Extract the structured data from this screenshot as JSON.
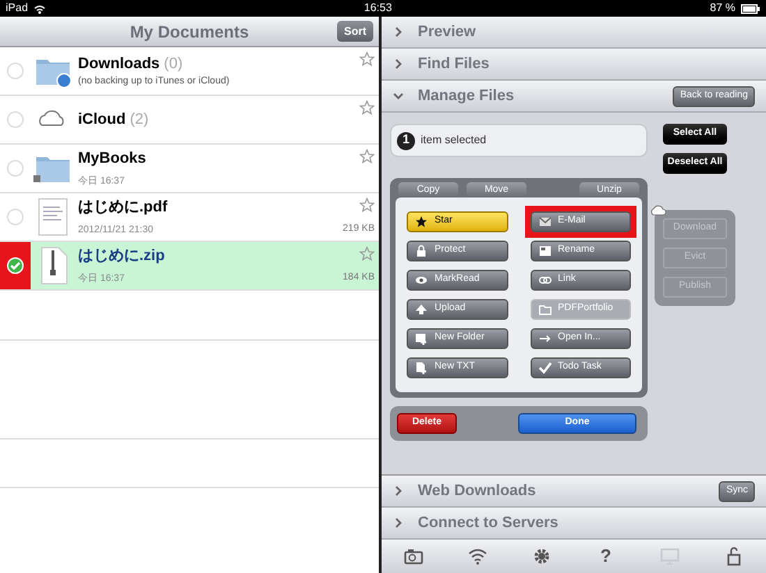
{
  "status_bar": {
    "carrier": "iPad",
    "time": "16:53",
    "battery": "87 %"
  },
  "documents": {
    "title": "My Documents",
    "sort_button": "Sort",
    "items": [
      {
        "kind": "folder-sync",
        "name": "Downloads",
        "count": "(0)",
        "subtitle": "(no backing up to iTunes or iCloud)",
        "selected": false,
        "highlighted": false
      },
      {
        "kind": "cloud",
        "name": "iCloud",
        "count": "(2)",
        "selected": false,
        "highlighted": false
      },
      {
        "kind": "folder-lock",
        "name": "MyBooks",
        "date": "今日 16:37",
        "selected": false,
        "highlighted": false
      },
      {
        "kind": "pdf",
        "name": "はじめに.pdf",
        "date": "2012/11/21 21:30",
        "size": "219 KB",
        "selected": false,
        "highlighted": false
      },
      {
        "kind": "zip",
        "name": "はじめに.zip",
        "date": "今日 16:37",
        "size": "184 KB",
        "selected": true,
        "highlighted": true
      }
    ]
  },
  "sections_top": [
    {
      "label": "Preview",
      "expanded": false
    },
    {
      "label": "Find Files",
      "expanded": false
    },
    {
      "label": "Manage Files",
      "expanded": true,
      "button": "Back to reading"
    }
  ],
  "manage": {
    "count": "1",
    "selection_text": "item selected",
    "select_all": "Select All",
    "deselect_all": "Deselect All",
    "tabs": [
      "Copy",
      "Move",
      "Unzip"
    ],
    "actions": [
      {
        "kind": "star",
        "label": "Star",
        "on": true,
        "disabled": false,
        "highlighted": false
      },
      {
        "kind": "mail",
        "label": "E-Mail",
        "on": false,
        "disabled": false,
        "highlighted": true
      },
      {
        "kind": "lock",
        "label": "Protect",
        "on": false,
        "disabled": false,
        "highlighted": false
      },
      {
        "kind": "rename",
        "label": "Rename",
        "on": false,
        "disabled": false,
        "highlighted": false
      },
      {
        "kind": "eye",
        "label": "MarkRead",
        "on": false,
        "disabled": false,
        "highlighted": false
      },
      {
        "kind": "link",
        "label": "Link",
        "on": false,
        "disabled": false,
        "highlighted": false
      },
      {
        "kind": "upload",
        "label": "Upload",
        "on": false,
        "disabled": false,
        "highlighted": false
      },
      {
        "kind": "folder",
        "label": "PDFPortfolio",
        "on": false,
        "disabled": true,
        "highlighted": false
      },
      {
        "kind": "new-folder",
        "label": "New Folder",
        "on": false,
        "disabled": false,
        "highlighted": false
      },
      {
        "kind": "open",
        "label": "Open In...",
        "on": false,
        "disabled": false,
        "highlighted": false
      },
      {
        "kind": "new-file",
        "label": "New TXT",
        "on": false,
        "disabled": false,
        "highlighted": false
      },
      {
        "kind": "check",
        "label": "Todo Task",
        "on": false,
        "disabled": false,
        "highlighted": false
      }
    ],
    "cloud_actions": [
      {
        "label": "Download",
        "disabled": true
      },
      {
        "label": "Evict",
        "disabled": true
      },
      {
        "label": "Publish",
        "disabled": true
      }
    ],
    "delete": "Delete",
    "done": "Done"
  },
  "sections_bottom": [
    {
      "label": "Web Downloads",
      "expanded": false,
      "button": "Sync"
    },
    {
      "label": "Connect to Servers",
      "expanded": false
    }
  ],
  "toolbar": [
    {
      "kind": "camera",
      "disabled": false
    },
    {
      "kind": "wifi",
      "disabled": false
    },
    {
      "kind": "gear",
      "disabled": false
    },
    {
      "kind": "help",
      "label": "?",
      "disabled": false
    },
    {
      "kind": "monitor",
      "disabled": true
    },
    {
      "kind": "lock",
      "disabled": false
    }
  ]
}
